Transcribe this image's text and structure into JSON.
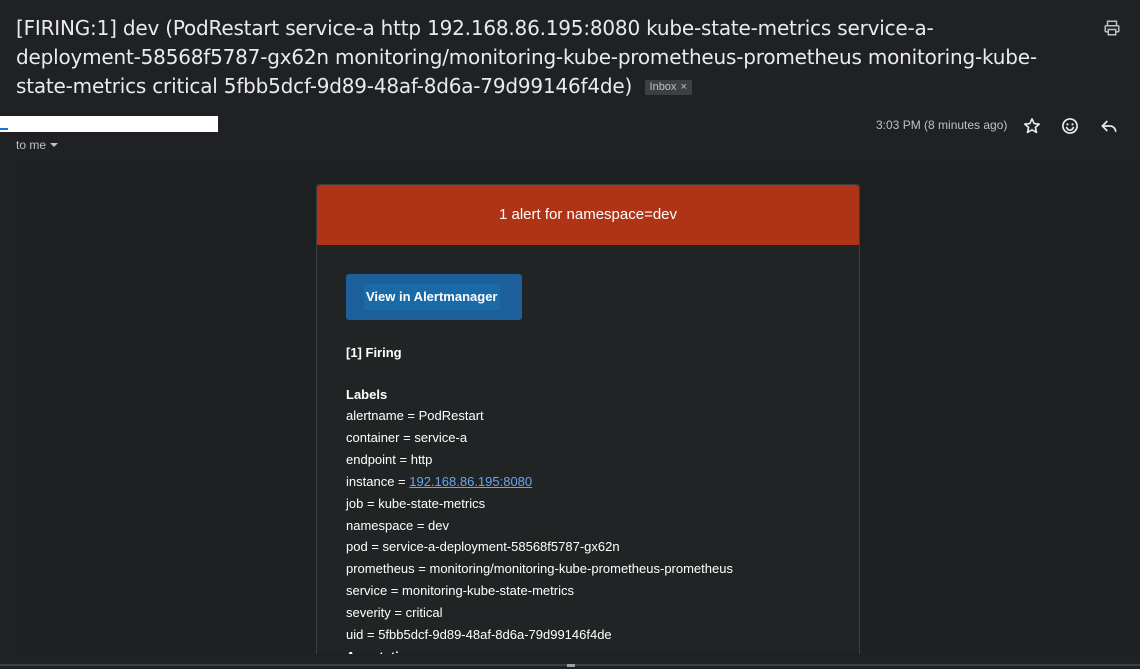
{
  "email": {
    "subject": "[FIRING:1] dev (PodRestart service-a http 192.168.86.195:8080 kube-state-metrics service-a-deployment-58568f5787-gx62n monitoring/monitoring-kube-prometheus-prometheus monitoring-kube-state-metrics critical 5fbb5dcf-9d89-48af-8d6a-79d99146f4de)",
    "label_chip": "Inbox",
    "label_chip_close": "×",
    "recipient": "to me",
    "timestamp": "3:03 PM (8 minutes ago)"
  },
  "icons": {
    "print": "print-icon",
    "star": "star-icon",
    "emoji": "emoji-icon",
    "reply": "reply-icon",
    "recipient_dropdown": "chevron-down-icon"
  },
  "alert": {
    "header": "1 alert for namespace=dev",
    "button_label": "View in Alertmanager",
    "firing_title": "[1] Firing",
    "labels_title": "Labels",
    "labels": [
      {
        "key": "alertname",
        "sep": " = ",
        "value": "PodRestart"
      },
      {
        "key": "container",
        "sep": " = ",
        "value": "service-a"
      },
      {
        "key": "endpoint",
        "sep": " = ",
        "value": "http"
      },
      {
        "key": "instance",
        "sep": " = ",
        "value": "192.168.86.195:8080"
      },
      {
        "key": "job",
        "sep": " = ",
        "value": "kube-state-metrics"
      },
      {
        "key": "namespace",
        "sep": " = ",
        "value": "dev"
      },
      {
        "key": "pod",
        "sep": " = ",
        "value": "service-a-deployment-58568f5787-gx62n"
      },
      {
        "key": "prometheus",
        "sep": " = ",
        "value": "monitoring/monitoring-kube-prometheus-prometheus"
      },
      {
        "key": "service",
        "sep": " = ",
        "value": "monitoring-kube-state-metrics"
      },
      {
        "key": "severity",
        "sep": " = ",
        "value": "critical"
      },
      {
        "key": "uid",
        "sep": " = ",
        "value": "5fbb5dcf-9d89-48af-8d6a-79d99146f4de"
      }
    ],
    "annotations_title": "Annotations"
  },
  "colors": {
    "alert_header": "#af3416",
    "button": "#1c5f9b",
    "link": "#6fa3f2",
    "background": "#202124"
  }
}
